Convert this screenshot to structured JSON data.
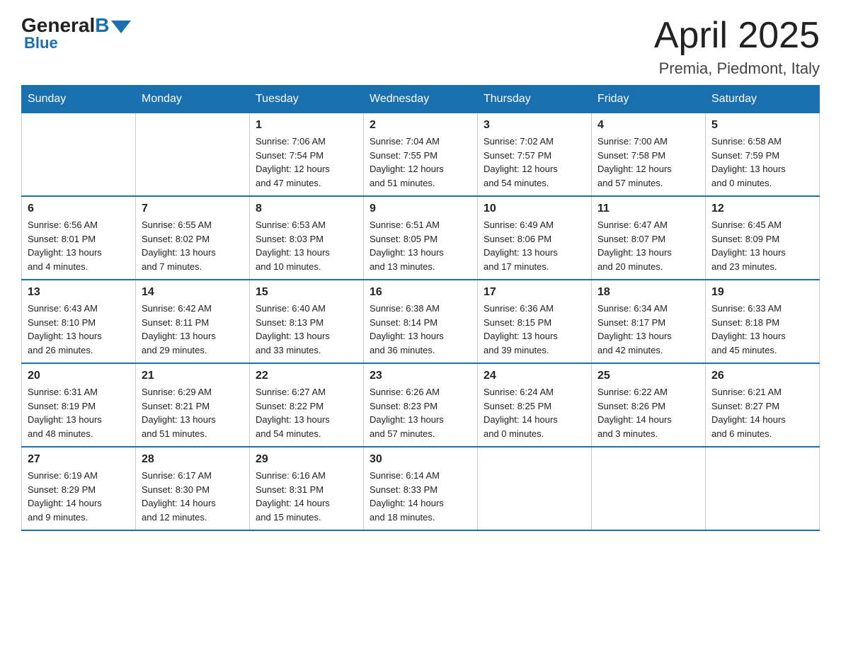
{
  "header": {
    "logo_general": "General",
    "logo_blue": "Blue",
    "month_title": "April 2025",
    "location": "Premia, Piedmont, Italy"
  },
  "weekdays": [
    "Sunday",
    "Monday",
    "Tuesday",
    "Wednesday",
    "Thursday",
    "Friday",
    "Saturday"
  ],
  "weeks": [
    [
      {
        "day": "",
        "info": ""
      },
      {
        "day": "",
        "info": ""
      },
      {
        "day": "1",
        "info": "Sunrise: 7:06 AM\nSunset: 7:54 PM\nDaylight: 12 hours\nand 47 minutes."
      },
      {
        "day": "2",
        "info": "Sunrise: 7:04 AM\nSunset: 7:55 PM\nDaylight: 12 hours\nand 51 minutes."
      },
      {
        "day": "3",
        "info": "Sunrise: 7:02 AM\nSunset: 7:57 PM\nDaylight: 12 hours\nand 54 minutes."
      },
      {
        "day": "4",
        "info": "Sunrise: 7:00 AM\nSunset: 7:58 PM\nDaylight: 12 hours\nand 57 minutes."
      },
      {
        "day": "5",
        "info": "Sunrise: 6:58 AM\nSunset: 7:59 PM\nDaylight: 13 hours\nand 0 minutes."
      }
    ],
    [
      {
        "day": "6",
        "info": "Sunrise: 6:56 AM\nSunset: 8:01 PM\nDaylight: 13 hours\nand 4 minutes."
      },
      {
        "day": "7",
        "info": "Sunrise: 6:55 AM\nSunset: 8:02 PM\nDaylight: 13 hours\nand 7 minutes."
      },
      {
        "day": "8",
        "info": "Sunrise: 6:53 AM\nSunset: 8:03 PM\nDaylight: 13 hours\nand 10 minutes."
      },
      {
        "day": "9",
        "info": "Sunrise: 6:51 AM\nSunset: 8:05 PM\nDaylight: 13 hours\nand 13 minutes."
      },
      {
        "day": "10",
        "info": "Sunrise: 6:49 AM\nSunset: 8:06 PM\nDaylight: 13 hours\nand 17 minutes."
      },
      {
        "day": "11",
        "info": "Sunrise: 6:47 AM\nSunset: 8:07 PM\nDaylight: 13 hours\nand 20 minutes."
      },
      {
        "day": "12",
        "info": "Sunrise: 6:45 AM\nSunset: 8:09 PM\nDaylight: 13 hours\nand 23 minutes."
      }
    ],
    [
      {
        "day": "13",
        "info": "Sunrise: 6:43 AM\nSunset: 8:10 PM\nDaylight: 13 hours\nand 26 minutes."
      },
      {
        "day": "14",
        "info": "Sunrise: 6:42 AM\nSunset: 8:11 PM\nDaylight: 13 hours\nand 29 minutes."
      },
      {
        "day": "15",
        "info": "Sunrise: 6:40 AM\nSunset: 8:13 PM\nDaylight: 13 hours\nand 33 minutes."
      },
      {
        "day": "16",
        "info": "Sunrise: 6:38 AM\nSunset: 8:14 PM\nDaylight: 13 hours\nand 36 minutes."
      },
      {
        "day": "17",
        "info": "Sunrise: 6:36 AM\nSunset: 8:15 PM\nDaylight: 13 hours\nand 39 minutes."
      },
      {
        "day": "18",
        "info": "Sunrise: 6:34 AM\nSunset: 8:17 PM\nDaylight: 13 hours\nand 42 minutes."
      },
      {
        "day": "19",
        "info": "Sunrise: 6:33 AM\nSunset: 8:18 PM\nDaylight: 13 hours\nand 45 minutes."
      }
    ],
    [
      {
        "day": "20",
        "info": "Sunrise: 6:31 AM\nSunset: 8:19 PM\nDaylight: 13 hours\nand 48 minutes."
      },
      {
        "day": "21",
        "info": "Sunrise: 6:29 AM\nSunset: 8:21 PM\nDaylight: 13 hours\nand 51 minutes."
      },
      {
        "day": "22",
        "info": "Sunrise: 6:27 AM\nSunset: 8:22 PM\nDaylight: 13 hours\nand 54 minutes."
      },
      {
        "day": "23",
        "info": "Sunrise: 6:26 AM\nSunset: 8:23 PM\nDaylight: 13 hours\nand 57 minutes."
      },
      {
        "day": "24",
        "info": "Sunrise: 6:24 AM\nSunset: 8:25 PM\nDaylight: 14 hours\nand 0 minutes."
      },
      {
        "day": "25",
        "info": "Sunrise: 6:22 AM\nSunset: 8:26 PM\nDaylight: 14 hours\nand 3 minutes."
      },
      {
        "day": "26",
        "info": "Sunrise: 6:21 AM\nSunset: 8:27 PM\nDaylight: 14 hours\nand 6 minutes."
      }
    ],
    [
      {
        "day": "27",
        "info": "Sunrise: 6:19 AM\nSunset: 8:29 PM\nDaylight: 14 hours\nand 9 minutes."
      },
      {
        "day": "28",
        "info": "Sunrise: 6:17 AM\nSunset: 8:30 PM\nDaylight: 14 hours\nand 12 minutes."
      },
      {
        "day": "29",
        "info": "Sunrise: 6:16 AM\nSunset: 8:31 PM\nDaylight: 14 hours\nand 15 minutes."
      },
      {
        "day": "30",
        "info": "Sunrise: 6:14 AM\nSunset: 8:33 PM\nDaylight: 14 hours\nand 18 minutes."
      },
      {
        "day": "",
        "info": ""
      },
      {
        "day": "",
        "info": ""
      },
      {
        "day": "",
        "info": ""
      }
    ]
  ]
}
